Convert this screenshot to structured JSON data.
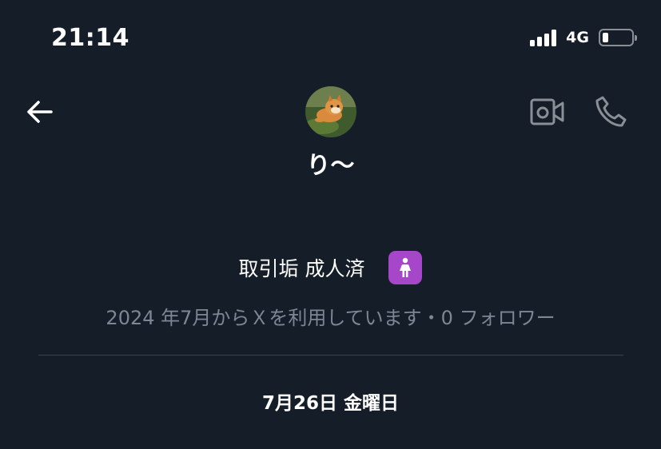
{
  "status_bar": {
    "time": "21:14",
    "network": "4G",
    "signal_bars": 4,
    "battery_level": 0.2
  },
  "header": {
    "back_icon": "arrow-left-icon",
    "video_icon": "video-camera-icon",
    "call_icon": "phone-icon",
    "display_name": "り〜"
  },
  "profile": {
    "bio_text": "取引垢 成人済",
    "bio_emoji_icon": "woman-symbol-icon",
    "bio_emoji_color": "#a646c8",
    "meta": "2024 年7月からＸを利用しています・0 フォロワー"
  },
  "conversation": {
    "date_label": "7月26日 金曜日"
  },
  "colors": {
    "background": "#151d28",
    "muted_text": "#7d8794",
    "icon_gray": "#8a8f96",
    "divider": "#384350"
  }
}
